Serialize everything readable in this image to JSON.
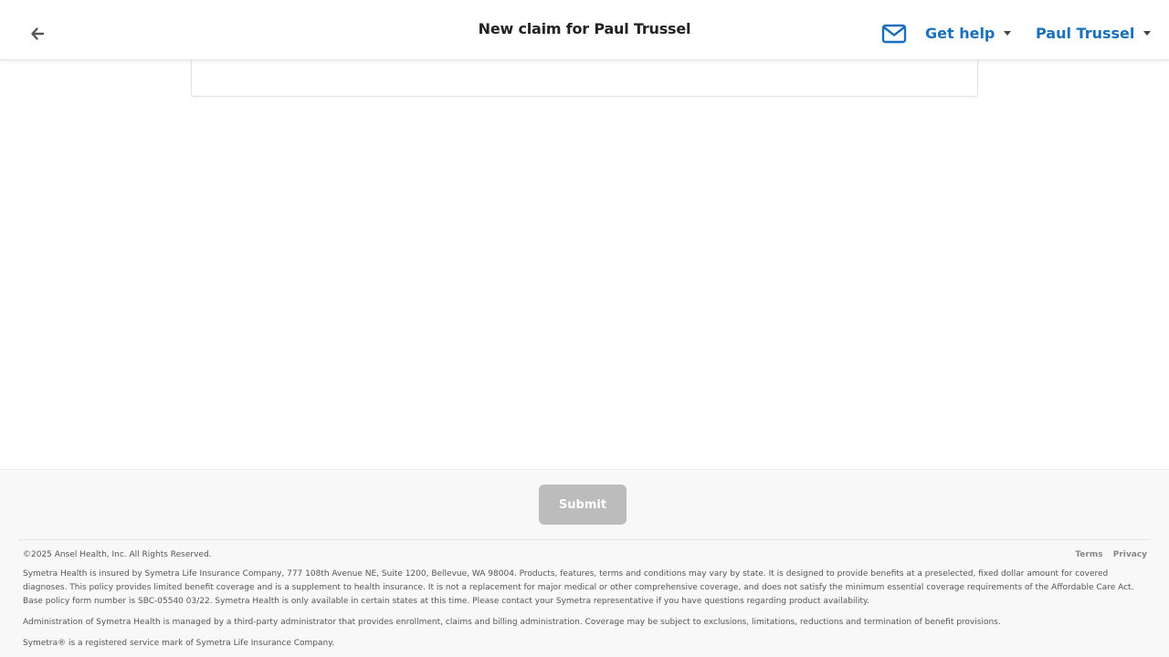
{
  "header": {
    "back_icon": "arrow-left-icon",
    "title": "New claim for Paul Trussel",
    "mail_icon": "envelope-icon",
    "help_label": "Get help",
    "user_label": "Paul Trussel",
    "accent_color": "#1a6fbf"
  },
  "footer": {
    "submit_label": "Submit",
    "copyright": "©2025 Ansel Health, Inc. All Rights Reserved.",
    "links": {
      "terms": "Terms",
      "privacy": "Privacy"
    },
    "legal_1": "Symetra Health is insured by Symetra Life Insurance Company, 777 108th Avenue NE, Suite 1200, Bellevue, WA 98004. Products, features, terms and conditions may vary by state. It is designed to provide benefits at a preselected, fixed dollar amount for covered diagnoses. This policy provides limited benefit coverage and is a supplement to health insurance. It is not a replacement for major medical or other comprehensive coverage, and does not satisfy the minimum essential coverage requirements of the Affordable Care Act. Base policy form number is SBC-05540 03/22. Symetra Health is only available in certain states at this time. Please contact your Symetra representative if you have questions regarding product availability.",
    "legal_2": "Administration of Symetra Health is managed by a third-party administrator that provides enrollment, claims and billing administration. Coverage may be subject to exclusions, limitations, reductions and termination of benefit provisions.",
    "legal_3": "Symetra® is a registered service mark of Symetra Life Insurance Company."
  }
}
